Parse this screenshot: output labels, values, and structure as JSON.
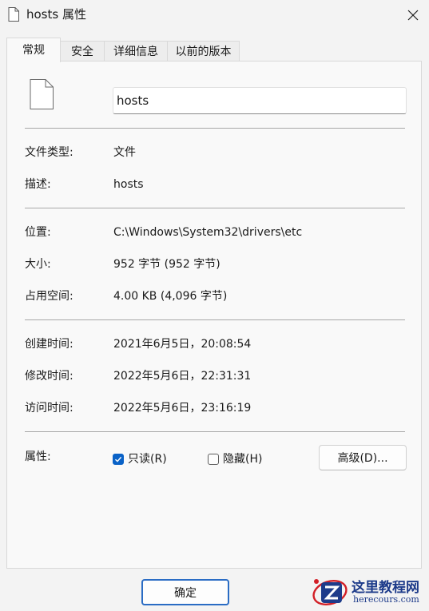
{
  "window": {
    "title": "hosts 属性",
    "close_icon": "close-icon",
    "file_icon": "file-icon"
  },
  "tabs": [
    {
      "label": "常规",
      "active": true
    },
    {
      "label": "安全",
      "active": false
    },
    {
      "label": "详细信息",
      "active": false
    },
    {
      "label": "以前的版本",
      "active": false
    }
  ],
  "general": {
    "file_name": "hosts",
    "file_type_label": "文件类型:",
    "file_type_value": "文件",
    "description_label": "描述:",
    "description_value": "hosts",
    "location_label": "位置:",
    "location_value": "C:\\Windows\\System32\\drivers\\etc",
    "size_label": "大小:",
    "size_value": "952 字节 (952 字节)",
    "size_on_disk_label": "占用空间:",
    "size_on_disk_value": "4.00 KB (4,096 字节)",
    "created_label": "创建时间:",
    "created_value": "2021年6月5日，20:08:54",
    "modified_label": "修改时间:",
    "modified_value": "2022年5月6日，22:31:31",
    "accessed_label": "访问时间:",
    "accessed_value": "2022年5月6日，23:16:19",
    "attributes_label": "属性:",
    "readonly_label": "只读(R)",
    "readonly_checked": true,
    "hidden_label": "隐藏(H)",
    "hidden_checked": false,
    "advanced_button": "高级(D)..."
  },
  "footer": {
    "ok_button": "确定"
  },
  "watermark": {
    "name": "这里教程网",
    "url": "herecours.com",
    "logo_icon": "z-logo-icon"
  },
  "colors": {
    "accent": "#0a62c7",
    "primary_border": "#2a6cc4",
    "background": "#f3f3f3",
    "panel": "#f9f9f9",
    "watermark": "#1d3b8a"
  }
}
